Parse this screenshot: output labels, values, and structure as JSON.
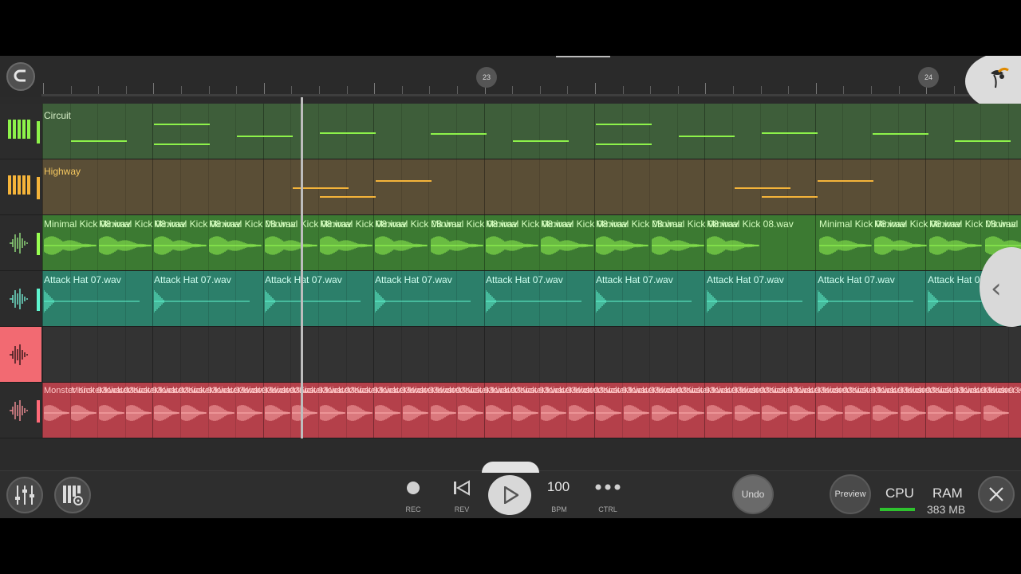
{
  "colors": {
    "background": "#2b2b2b",
    "circuit": "#3e5e3a",
    "highway": "#5a4e36",
    "kick": "#3c7a32",
    "hat": "#2c7f6a",
    "empty": "#333333",
    "monster": "#b4404a",
    "selected_track": "#f26a72"
  },
  "ruler": {
    "markers": [
      {
        "label": "23"
      },
      {
        "label": "24"
      }
    ]
  },
  "icons": {
    "snap": "magnet-icon",
    "logo": "fl-fruit-logo-icon",
    "side_tab": "chevron-left-icon",
    "mixer": "mixer-sliders-icon",
    "piano_settings": "piano-settings-icon",
    "rec": "record-dot-icon",
    "rev": "skip-back-icon",
    "play": "play-icon",
    "ctrl": "more-dots-icon",
    "close": "close-icon"
  },
  "tracks": [
    {
      "type": "pattern",
      "name": "Circuit",
      "color": "#3e5e3a",
      "note_color": "#8df24a",
      "name_color": "#d8f0c8"
    },
    {
      "type": "pattern",
      "name": "Highway",
      "color": "#5a4e36",
      "note_color": "#f5b43a",
      "name_color": "#f5c860"
    },
    {
      "type": "audio",
      "clip": "Minimal Kick 08.wav",
      "color": "#3c7a32",
      "wave_color": "#98ff52",
      "name_color": "#d6ffc0"
    },
    {
      "type": "audio",
      "clip": "Attack Hat 07.wav",
      "color": "#2c7f6a",
      "wave_color": "#5ff5cf",
      "name_color": "#d0fff0"
    },
    {
      "type": "audio",
      "clip": "",
      "color": "#333333"
    },
    {
      "type": "audio",
      "clip": "Monster Kick 03.wav",
      "color": "#b4404a",
      "wave_color": "#ffb0b0",
      "name_color": "#ffc8c8"
    }
  ],
  "toolbar": {
    "rec_label": "REC",
    "rev_label": "REV",
    "bpm_value": "100",
    "bpm_label": "BPM",
    "ctrl_label": "CTRL",
    "undo_label": "Undo",
    "preview_label": "Preview",
    "cpu_label": "CPU",
    "ram_label": "RAM",
    "ram_value": "383 MB"
  }
}
